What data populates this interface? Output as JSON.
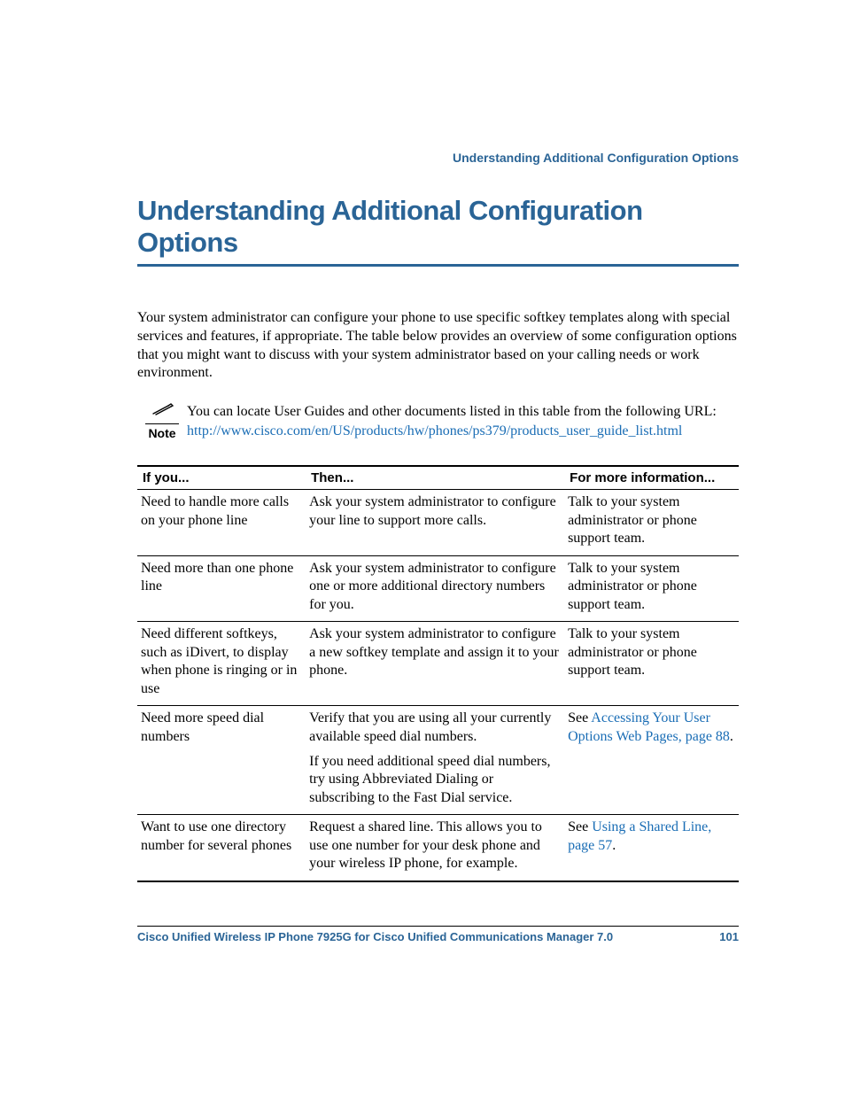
{
  "running_head": "Understanding Additional Configuration Options",
  "heading": "Understanding Additional Configuration Options",
  "intro": "Your system administrator can configure your phone to use specific softkey templates along with special services and features, if appropriate. The table below provides an overview of some configuration options that you might want to discuss with your system administrator based on your calling needs or work environment.",
  "note": {
    "label": "Note",
    "text": "You can locate User Guides and other documents listed in this table from the following URL: ",
    "url": "http://www.cisco.com/en/US/products/hw/phones/ps379/products_user_guide_list.html"
  },
  "table": {
    "headers": [
      "If you...",
      "Then...",
      "For more information..."
    ],
    "rows": [
      {
        "if": "Need to handle more calls on your phone line",
        "then": [
          "Ask your system administrator to configure your line to support more calls."
        ],
        "more_pre": "Talk to your system administrator or phone support team.",
        "more_link": "",
        "more_post": ""
      },
      {
        "if": "Need more than one phone line",
        "then": [
          "Ask your system administrator to configure one or more additional directory numbers for you."
        ],
        "more_pre": "Talk to your system administrator or phone support team.",
        "more_link": "",
        "more_post": ""
      },
      {
        "if": "Need different softkeys, such as iDivert, to display when phone is ringing or in use",
        "then": [
          "Ask your system administrator to configure a new softkey template and assign it to your phone."
        ],
        "more_pre": "Talk to your system administrator or phone support team.",
        "more_link": "",
        "more_post": ""
      },
      {
        "if": "Need more speed dial numbers",
        "then": [
          "Verify that you are using all your currently available speed dial numbers.",
          "If you need additional speed dial numbers, try using Abbreviated Dialing or subscribing to the Fast Dial service."
        ],
        "more_pre": "See ",
        "more_link": "Accessing Your User Options Web Pages, page 88",
        "more_post": "."
      },
      {
        "if": "Want to use one directory number for several phones",
        "then": [
          "Request a shared line. This allows you to use one number for your desk phone and your wireless IP phone, for example."
        ],
        "more_pre": "See ",
        "more_link": "Using a Shared Line, page 57",
        "more_post": "."
      }
    ]
  },
  "footer": {
    "title": "Cisco Unified Wireless IP Phone 7925G for Cisco Unified Communications Manager 7.0",
    "page": "101"
  }
}
